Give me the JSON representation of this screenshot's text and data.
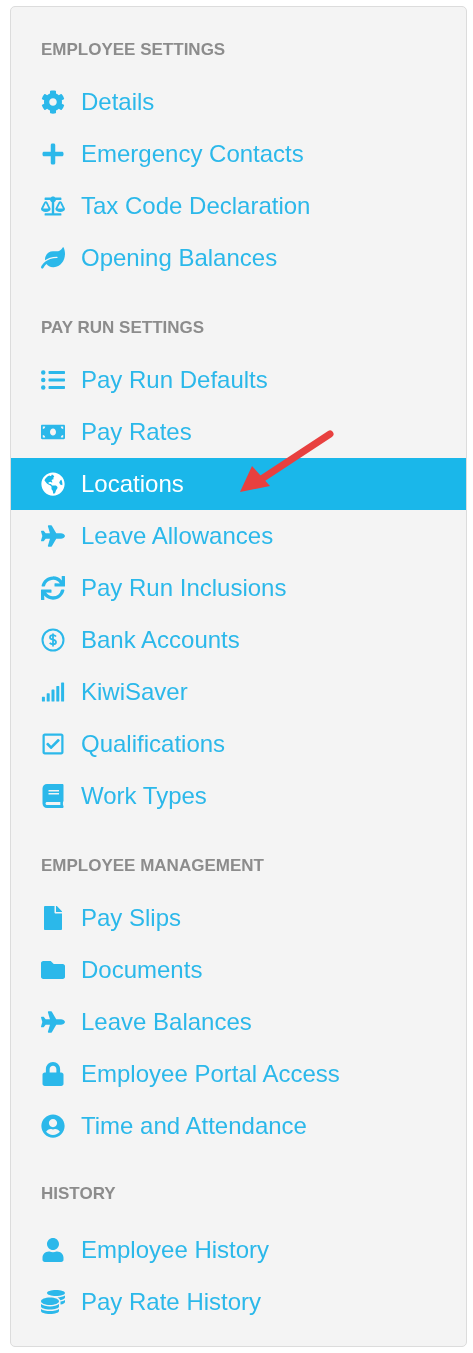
{
  "sections": [
    {
      "heading": "EMPLOYEE SETTINGS",
      "items": [
        {
          "label": "Details",
          "selected": false
        },
        {
          "label": "Emergency Contacts",
          "selected": false
        },
        {
          "label": "Tax Code Declaration",
          "selected": false
        },
        {
          "label": "Opening Balances",
          "selected": false
        }
      ]
    },
    {
      "heading": "PAY RUN SETTINGS",
      "items": [
        {
          "label": "Pay Run Defaults",
          "selected": false
        },
        {
          "label": "Pay Rates",
          "selected": false
        },
        {
          "label": "Locations",
          "selected": true
        },
        {
          "label": "Leave Allowances",
          "selected": false
        },
        {
          "label": "Pay Run Inclusions",
          "selected": false
        },
        {
          "label": "Bank Accounts",
          "selected": false
        },
        {
          "label": "KiwiSaver",
          "selected": false
        },
        {
          "label": "Qualifications",
          "selected": false
        },
        {
          "label": "Work Types",
          "selected": false
        }
      ]
    },
    {
      "heading": "EMPLOYEE MANAGEMENT",
      "items": [
        {
          "label": "Pay Slips",
          "selected": false
        },
        {
          "label": "Documents",
          "selected": false
        },
        {
          "label": "Leave Balances",
          "selected": false
        },
        {
          "label": "Employee Portal Access",
          "selected": false
        },
        {
          "label": "Time and Attendance",
          "selected": false
        }
      ]
    },
    {
      "heading": "HISTORY",
      "items": [
        {
          "label": "Employee History",
          "selected": false
        },
        {
          "label": "Pay Rate History",
          "selected": false
        }
      ]
    }
  ]
}
